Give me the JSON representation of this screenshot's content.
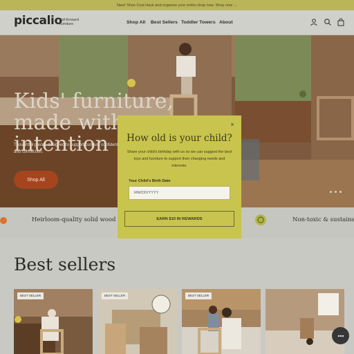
{
  "announcement": "New! Shoe Cost Hack and organize your entire shop now. Shop now →",
  "header": {
    "logo": "piccalio",
    "tagline": "Kid-forward furniture",
    "nav": [
      "Shop All",
      "Best Sellers",
      "Toddler Towers",
      "About"
    ],
    "icons": [
      "account-icon",
      "search-icon",
      "cart-icon"
    ]
  },
  "hero": {
    "title_line1": "Kids' furniture,",
    "title_line2": "made with",
    "title_line3": "intention",
    "subtitle": "Thoughtful pieces designed to support curious, confident kids—and connection.",
    "cta": "Shop All",
    "slides_total": 3
  },
  "features": [
    "Heirloom-quality solid wood",
    "Non-toxic & sustainably"
  ],
  "best_sellers": {
    "title": "Best sellers",
    "badge": "BEST SELLER",
    "cards": [
      {
        "badge": "BEST SELLER"
      },
      {
        "badge": "BEST SELLER",
        "extra": "The Everyday Baby Magazine Award"
      },
      {
        "badge": "BEST SELLER"
      },
      {
        "badge": "",
        "extra": "Good Design Awards"
      }
    ]
  },
  "modal": {
    "title": "How old is your child?",
    "text": "Share your child's birthday with us so we can suggest the best toys and furniture to support their changing needs and interests.",
    "field_label": "Your Child's Birth Date",
    "placeholder": "MM/DD/YYYY",
    "button": "EARN $10 IN REWARDS",
    "close": "×"
  },
  "colors": {
    "announcement_bg": "#b9b558",
    "modal_bg": "#c9c44d",
    "cta_bg": "#a5451e",
    "overlay": "#c9c9c3"
  }
}
